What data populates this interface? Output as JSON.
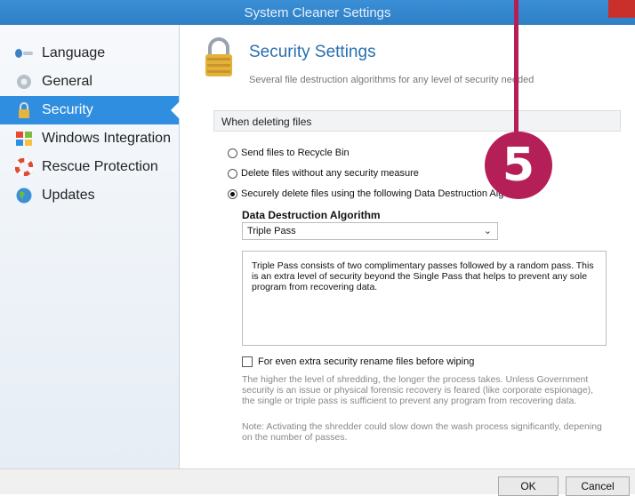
{
  "window": {
    "title": "System Cleaner Settings"
  },
  "sidebar": {
    "items": [
      {
        "label": "Language",
        "icon": "language-icon"
      },
      {
        "label": "General",
        "icon": "gear-icon"
      },
      {
        "label": "Security",
        "icon": "lock-icon",
        "active": true
      },
      {
        "label": "Windows Integration",
        "icon": "windows-flag-icon"
      },
      {
        "label": "Rescue Protection",
        "icon": "lifebuoy-icon"
      },
      {
        "label": "Updates",
        "icon": "globe-icon"
      }
    ]
  },
  "main": {
    "heading": "Security Settings",
    "subheading": "Several file destruction algorithms for any level of security needed",
    "section_title": "When deleting files",
    "options": [
      {
        "label": "Send files to Recycle Bin",
        "checked": false
      },
      {
        "label": "Delete files without any security measure",
        "checked": false
      },
      {
        "label": "Securely delete files using the following Data Destruction Algorithm",
        "checked": true
      }
    ],
    "algorithm_label": "Data Destruction Algorithm",
    "algorithm_selected": "Triple Pass",
    "algorithm_description": "Triple Pass consists of two complimentary passes followed by a random pass. This is an extra level of security beyond the Single Pass that helps to prevent any sole program from recovering data.",
    "rename_checkbox_label": "For even extra security rename files before wiping",
    "rename_checked": false,
    "info_note": "The higher the level of shredding, the longer the process takes. Unless Government security is an issue or physical forensic recovery is feared (like corporate espionage), the single or triple pass is sufficient to prevent any program from recovering data.",
    "shredder_note": "Note: Activating the shredder could slow down the wash process significantly, depening on the number of passes."
  },
  "footer": {
    "ok_label": "OK",
    "cancel_label": "Cancel"
  },
  "callout": {
    "number": "5",
    "color": "#b51f57"
  },
  "colors": {
    "accent": "#2f8ee0",
    "heading": "#2a6fb0"
  }
}
